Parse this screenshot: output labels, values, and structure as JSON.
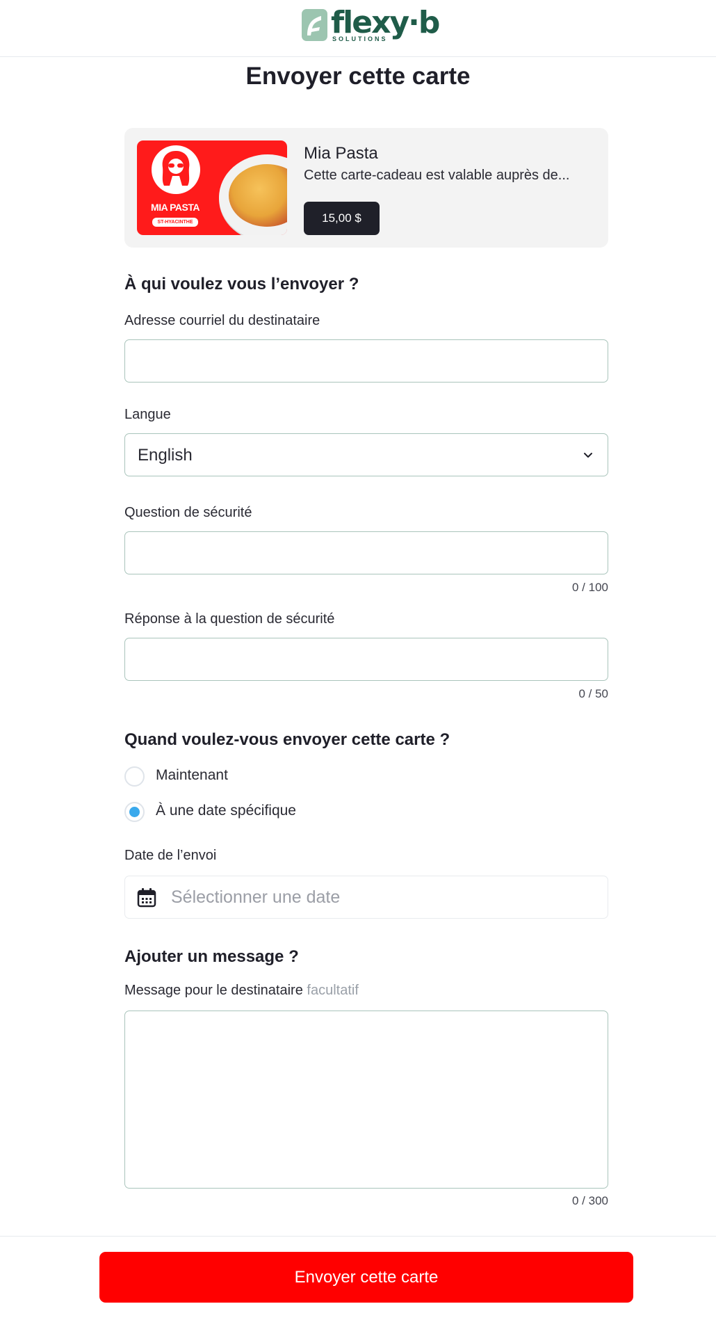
{
  "header": {
    "logo_word": "flexy·b",
    "logo_sub": "SOLUTIONS"
  },
  "page": {
    "title": "Envoyer cette carte"
  },
  "card": {
    "brand_text": "MIA PASTA",
    "brand_location": "ST-HYACINTHE",
    "name": "Mia Pasta",
    "description": "Cette carte-cadeau est valable auprès de...",
    "price": "15,00 $"
  },
  "recipient": {
    "heading": "À qui voulez vous l’envoyer ?",
    "email_label": "Adresse courriel du destinataire",
    "email_value": "",
    "language_label": "Langue",
    "language_value": "English",
    "question_label": "Question de sécurité",
    "question_value": "",
    "question_counter": "0 / 100",
    "answer_label": "Réponse à la question de sécurité",
    "answer_value": "",
    "answer_counter": "0 / 50"
  },
  "schedule": {
    "heading": "Quand voulez-vous envoyer cette carte ?",
    "options": [
      {
        "label": "Maintenant",
        "checked": false
      },
      {
        "label": "À une date spécifique",
        "checked": true
      }
    ],
    "date_label": "Date de l’envoi",
    "date_placeholder": "Sélectionner une date"
  },
  "message": {
    "heading": "Ajouter un message ?",
    "label": "Message pour le destinataire",
    "optional": "facultatif",
    "counter": "0 / 300"
  },
  "footer": {
    "submit_label": "Envoyer cette carte"
  },
  "colors": {
    "brand_green": "#1f5c49",
    "accent_red": "#ff0000",
    "radio_blue": "#3aa9ec",
    "badge_dark": "#1f2029",
    "input_border": "#a9c4bb"
  }
}
